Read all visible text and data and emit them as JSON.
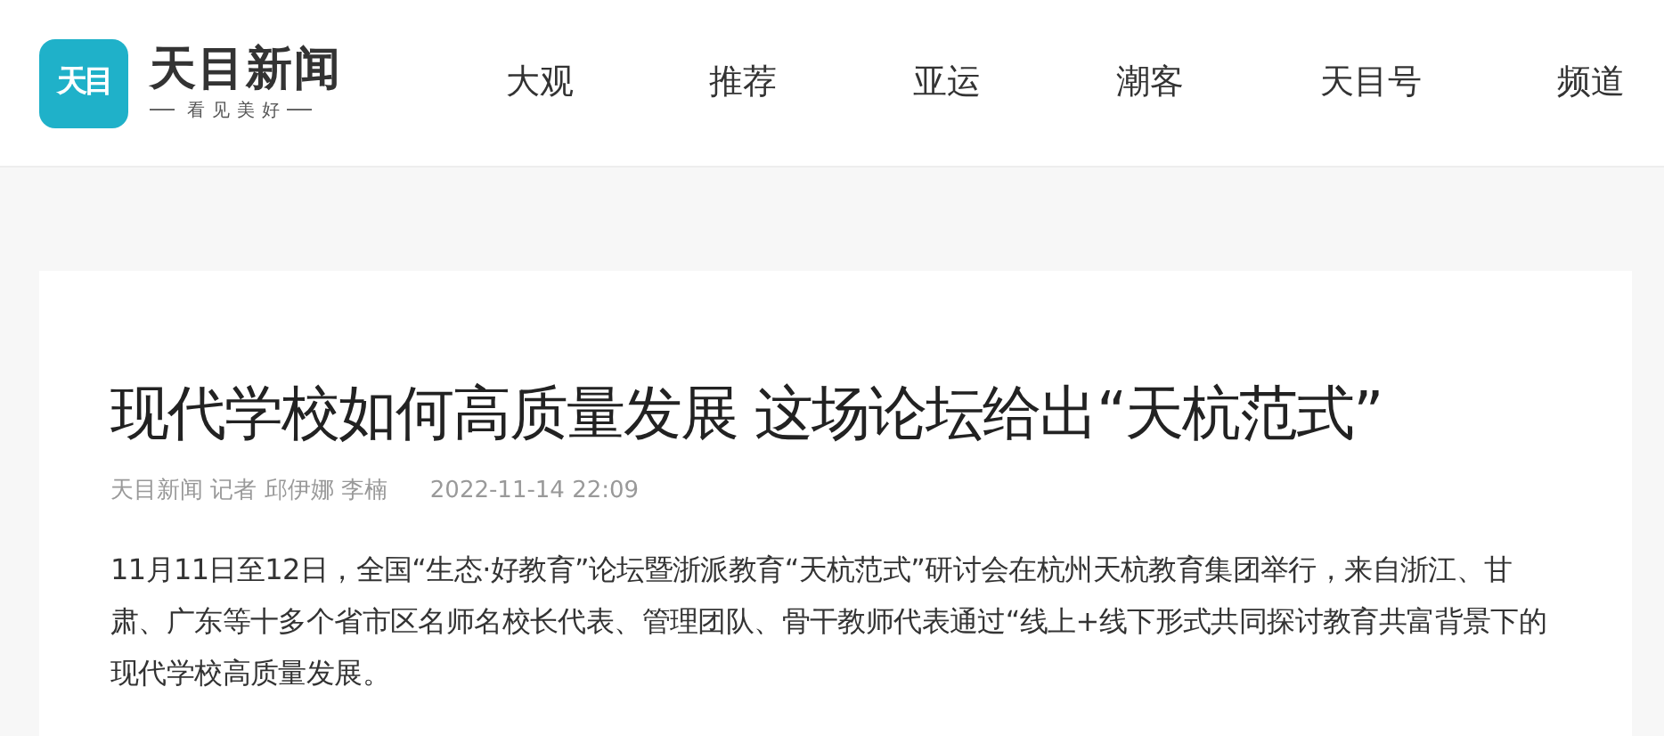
{
  "logo": {
    "mark": "天目",
    "name": "天目新闻",
    "slogan": "看见美好"
  },
  "nav": [
    {
      "label": "大观"
    },
    {
      "label": "推荐"
    },
    {
      "label": "亚运"
    },
    {
      "label": "潮客"
    },
    {
      "label": "天目号"
    },
    {
      "label": "频道"
    }
  ],
  "article": {
    "title": "现代学校如何高质量发展 这场论坛给出“天杭范式”",
    "byline": "天目新闻 记者 邱伊娜 李楠",
    "time": "2022-11-14 22:09",
    "body": "11月11日至12日，全国“生态·好教育”论坛暨浙派教育“天杭范式”研讨会在杭州天杭教育集团举行，来自浙江、甘肃、广东等十多个省市区名师名校长代表、管理团队、骨干教师代表通过“线上+线下形式共同探讨教育共富背景下的现代学校高质量发展。"
  }
}
